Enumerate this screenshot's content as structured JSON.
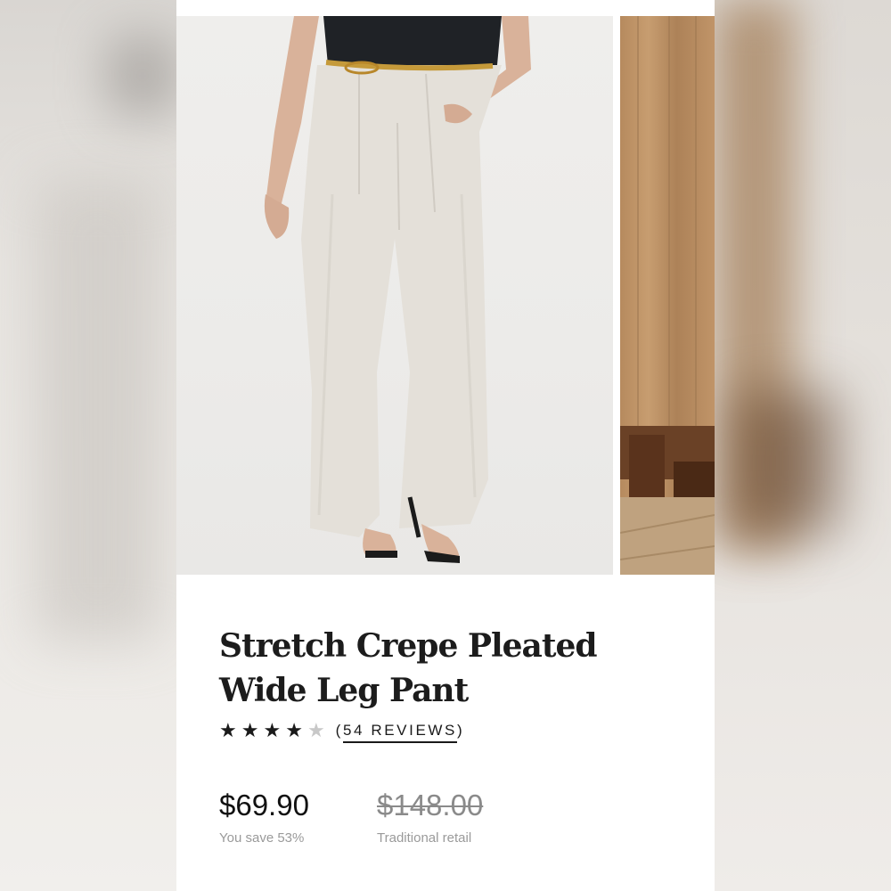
{
  "product": {
    "title": "Stretch Crepe Pleated Wide Leg Pant",
    "rating": {
      "value": 4,
      "max": 5,
      "reviews_label": "54 REVIEWS"
    },
    "price": {
      "sale": "$69.90",
      "savings": "You save 53%",
      "retail": "$148.00",
      "retail_label": "Traditional retail"
    }
  },
  "gallery": {
    "images": [
      {
        "name": "product-photo-model",
        "alt": "Model wearing stone pleated wide leg pants"
      },
      {
        "name": "product-photo-lifestyle",
        "alt": "Wood interior lifestyle shot"
      }
    ]
  },
  "colors": {
    "pant": "#e4e0d9",
    "accent_text": "#1a1a1a",
    "muted_text": "#9a9a9a"
  }
}
